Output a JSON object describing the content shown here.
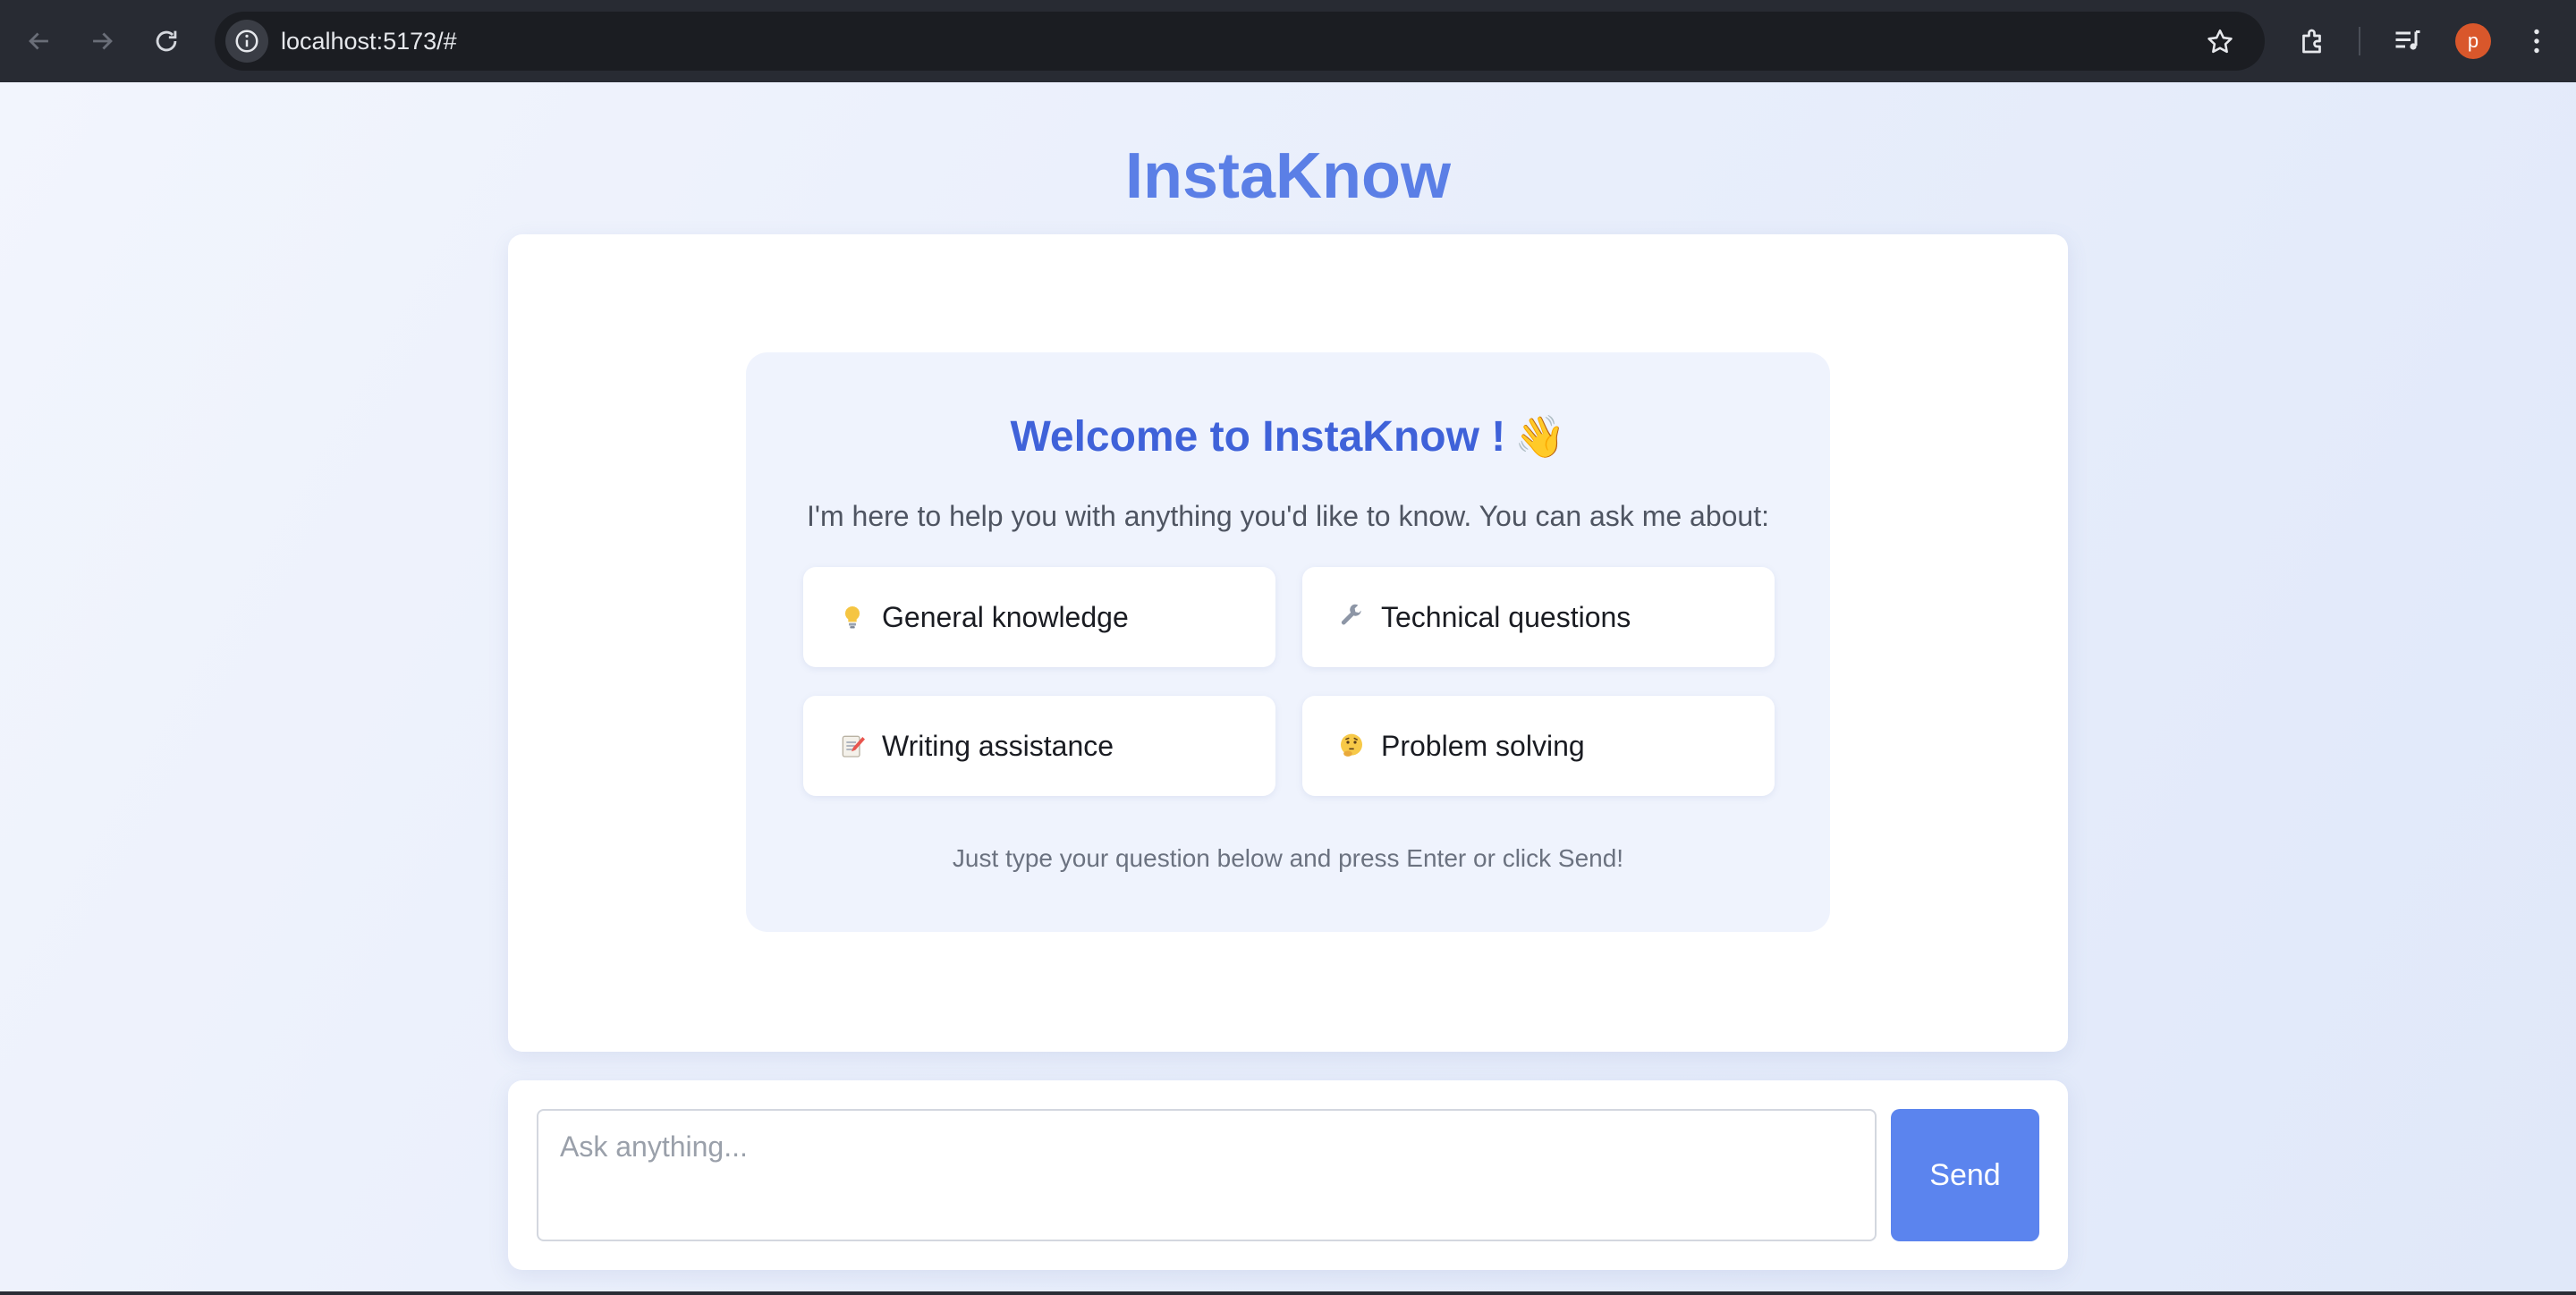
{
  "browser": {
    "url": "localhost:5173/#",
    "avatar_initial": "p",
    "icons": [
      "back-arrow-icon",
      "forward-arrow-icon",
      "reload-icon",
      "site-info-icon",
      "star-icon",
      "extensions-icon",
      "media-controls-icon",
      "kebab-menu-icon"
    ]
  },
  "app": {
    "title": "InstaKnow"
  },
  "welcome": {
    "title": "Welcome to InstaKnow !",
    "wave_emoji": "👋",
    "subtitle": "I'm here to help you with anything you'd like to know. You can ask me about:",
    "topics": [
      {
        "icon": "lightbulb-icon",
        "label": "General knowledge"
      },
      {
        "icon": "wrench-icon",
        "label": "Technical questions"
      },
      {
        "icon": "memo-icon",
        "label": "Writing assistance"
      },
      {
        "icon": "thinking-face-icon",
        "label": "Problem solving"
      }
    ],
    "hint": "Just type your question below and press Enter or click Send!"
  },
  "input": {
    "placeholder": "Ask anything...",
    "value": "",
    "send_label": "Send"
  },
  "colors": {
    "brand": "#5b7fe6",
    "welcome_title": "#3f62d9",
    "send_button": "#5b84ee",
    "avatar": "#d9572b"
  }
}
